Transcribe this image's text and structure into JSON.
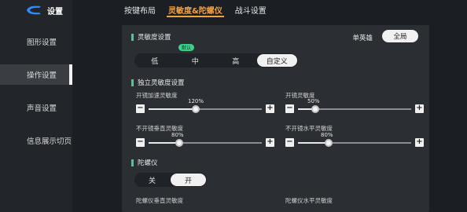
{
  "sidebar": {
    "title": "设置",
    "items": [
      {
        "label": "图形设置"
      },
      {
        "label": "操作设置"
      },
      {
        "label": "声音设置"
      },
      {
        "label": "信息展示切页"
      }
    ]
  },
  "tabs": [
    {
      "label": "按键布局"
    },
    {
      "label": "灵敏度&陀螺仪"
    },
    {
      "label": "战斗设置"
    }
  ],
  "sensitivity": {
    "title": "灵敏度设置",
    "mode_label": "单英雄",
    "global_label": "全局",
    "default_badge": "默认",
    "options": [
      "低",
      "中",
      "高",
      "自定义"
    ],
    "selected": "自定义"
  },
  "independent": {
    "title": "独立灵敏度设置",
    "sliders": [
      {
        "label": "开镜加速灵敏度",
        "value_text": "120%",
        "fraction": 0.42
      },
      {
        "label": "开镜灵敏度",
        "value_text": "50%",
        "fraction": 0.15
      },
      {
        "label": "不开镜垂直灵敏度",
        "value_text": "80%",
        "fraction": 0.27
      },
      {
        "label": "不开镜水平灵敏度",
        "value_text": "80%",
        "fraction": 0.27
      }
    ]
  },
  "gyro": {
    "title": "陀螺仪",
    "options": [
      "关",
      "开"
    ],
    "selected": "开",
    "vertical_label": "陀螺仪垂直灵敏度",
    "horizontal_label": "陀螺仪水平灵敏度"
  },
  "colors": {
    "accent_orange": "#f4a23c",
    "accent_green": "#3fd08a",
    "panel": "#2b2f34"
  }
}
